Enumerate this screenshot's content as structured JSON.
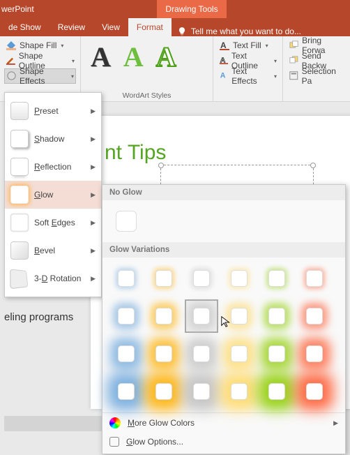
{
  "app": {
    "name_fragment": "werPoint",
    "context_tab": "Drawing Tools"
  },
  "tabs": {
    "items": [
      "de Show",
      "Review",
      "View",
      "Format"
    ],
    "active_index": 3,
    "tell_me": "Tell me what you want to do..."
  },
  "ribbon": {
    "shape_group": {
      "fill": "Shape Fill",
      "outline": "Shape Outline",
      "effects": "Shape Effects"
    },
    "wordart_group_label": "WordArt Styles",
    "text_group": {
      "fill": "Text Fill",
      "outline": "Text Outline",
      "effects": "Text Effects"
    },
    "arrange_group": {
      "bring_fwd": "Bring Forwa",
      "send_bwd": "Send Backw",
      "selection": "Selection Pa"
    }
  },
  "effects_menu": {
    "items": [
      {
        "label": "Preset",
        "accel": "P",
        "kind": "preset"
      },
      {
        "label": "Shadow",
        "accel": "S",
        "kind": "shadow"
      },
      {
        "label": "Reflection",
        "accel": "R",
        "kind": "reflect"
      },
      {
        "label": "Glow",
        "accel": "G",
        "kind": "glow",
        "hover": true
      },
      {
        "label": "Soft Edges",
        "accel": "E",
        "kind": "soft"
      },
      {
        "label": "Bevel",
        "accel": "B",
        "kind": "bevel"
      },
      {
        "label": "3-D Rotation",
        "accel": "D",
        "kind": "rot3d"
      }
    ]
  },
  "glow_panel": {
    "no_glow_label": "No Glow",
    "variations_label": "Glow Variations",
    "more_colors": "More Glow Colors",
    "options": "Glow Options...",
    "palette": [
      "#6fa8dc",
      "#ffb000",
      "#c0c0c0",
      "#ffd966",
      "#8fce00",
      "#ff5c33"
    ],
    "rows": 4,
    "selected": {
      "row": 1,
      "col": 2
    }
  },
  "slide": {
    "title_fragment": "nt Tips",
    "side_text": "eling programs"
  }
}
